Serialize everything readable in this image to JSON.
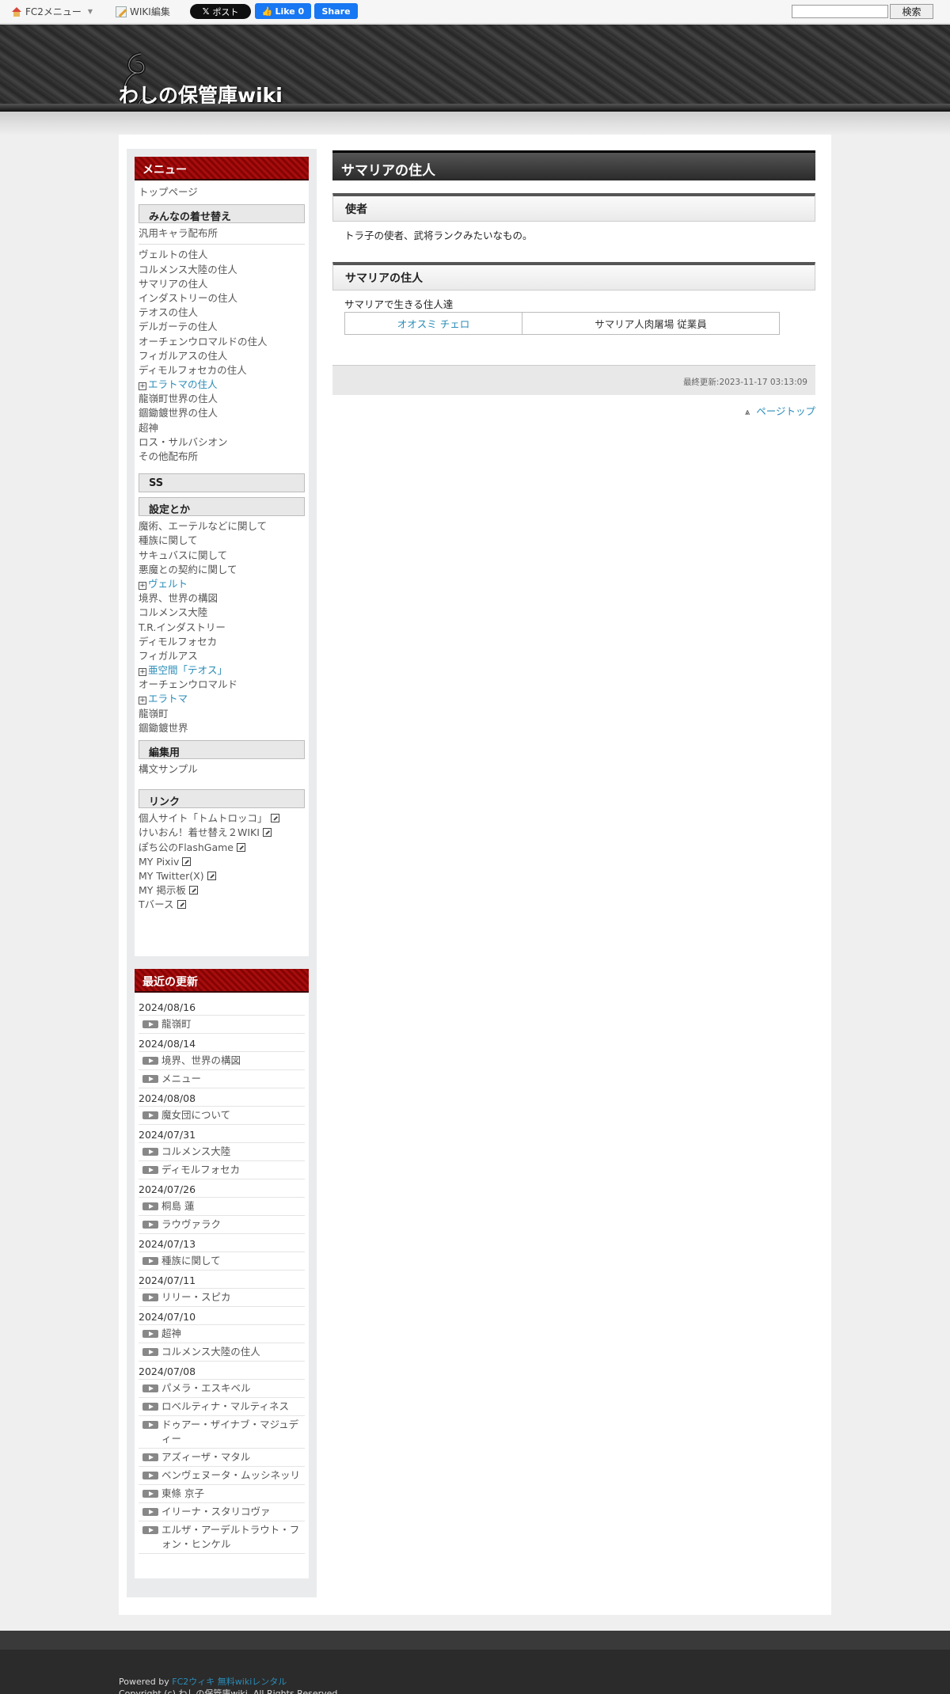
{
  "topbar": {
    "fc2_menu": "FC2メニュー",
    "wiki_edit": "WIKI編集",
    "x_post": "ポスト",
    "fb_like": "Like 0",
    "fb_share": "Share",
    "search_button": "検索"
  },
  "header": {
    "site_title": "わしの保管庫wiki"
  },
  "sidebar": {
    "menu_title": "メニュー",
    "top_link": "トップページ",
    "sec1": "みんなの着せ替え",
    "sec1_first": "汎用キャラ配布所",
    "sec1_items": [
      "ヴェルトの住人",
      "コルメンス大陸の住人",
      "サマリアの住人",
      "インダストリーの住人",
      "テオスの住人",
      "デルガーテの住人",
      "オーチェンウロマルドの住人",
      "フィガルアスの住人",
      "ディモルフォセカの住人"
    ],
    "sec1_expand": "エラトマの住人",
    "sec1_items2": [
      "龍嶺町世界の住人",
      "錮鋤鍍世界の住人",
      "超神",
      "ロス・サルバシオン",
      "その他配布所"
    ],
    "sec_ss": "SS",
    "sec_settings": "設定とか",
    "settings_a": [
      "魔術、エーテルなどに関して",
      "種族に関して",
      "サキュバスに関して",
      "悪魔との契約に関して"
    ],
    "settings_expand1": "ヴェルト",
    "settings_b": [
      "境界、世界の構図",
      "コルメンス大陸",
      "T.R.インダストリー",
      "ディモルフォセカ",
      "フィガルアス"
    ],
    "settings_expand2": "亜空間「テオス」",
    "settings_c": [
      "オーチェンウロマルド"
    ],
    "settings_expand3": "エラトマ",
    "settings_d": [
      "龍嶺町",
      "錮鋤鍍世界"
    ],
    "sec_edit": "編集用",
    "edit_item": "構文サンプル",
    "sec_link": "リンク",
    "links": [
      "個人サイト「トムトロッコ」",
      "けいおん！着せ替え２WIKI",
      "ぽち公のFlashGame",
      "MY Pixiv",
      "MY Twitter(X)",
      "MY 掲示板",
      "Tバース"
    ]
  },
  "recent": {
    "title": "最近の更新",
    "groups": [
      {
        "date": "2024/08/16",
        "items": [
          "龍嶺町"
        ]
      },
      {
        "date": "2024/08/14",
        "items": [
          "境界、世界の構図",
          "メニュー"
        ]
      },
      {
        "date": "2024/08/08",
        "items": [
          "魔女団について"
        ]
      },
      {
        "date": "2024/07/31",
        "items": [
          "コルメンス大陸",
          "ディモルフォセカ"
        ]
      },
      {
        "date": "2024/07/26",
        "items": [
          "桐島 蓮",
          "ラウヴァラク"
        ]
      },
      {
        "date": "2024/07/13",
        "items": [
          "種族に関して"
        ]
      },
      {
        "date": "2024/07/11",
        "items": [
          "リリー・スピカ"
        ]
      },
      {
        "date": "2024/07/10",
        "items": [
          "超神",
          "コルメンス大陸の住人"
        ]
      },
      {
        "date": "2024/07/08",
        "items": [
          "パメラ・エスキベル",
          "ロベルティナ・マルティネス",
          "ドゥアー・ザイナブ・マジュディー",
          "アズィーザ・マタル",
          "ベンヴェヌータ・ムッシネッリ",
          "東條 京子",
          "イリーナ・スタリコヴァ",
          "エルザ・アーデルトラウト・フォン・ヒンケル"
        ]
      }
    ]
  },
  "content": {
    "page_title": "サマリアの住人",
    "h_envoy": "使者",
    "envoy_text": "トラ子の使者、武将ランクみたいなもの。",
    "h_residents": "サマリアの住人",
    "residents_text": "サマリアで生きる住人達",
    "table": {
      "name": "オオスミ チェロ",
      "role": "サマリア人肉屠場 従業員"
    },
    "last_updated": "最終更新:2023-11-17 03:13:09",
    "page_top": "ページトップ"
  },
  "footer": {
    "powered_by": "Powered by",
    "powered_link": "FC2ウィキ 無料wikiレンタル",
    "copyright": "Copyright (c) わしの保管庫wiki. All Rights Reserved."
  }
}
